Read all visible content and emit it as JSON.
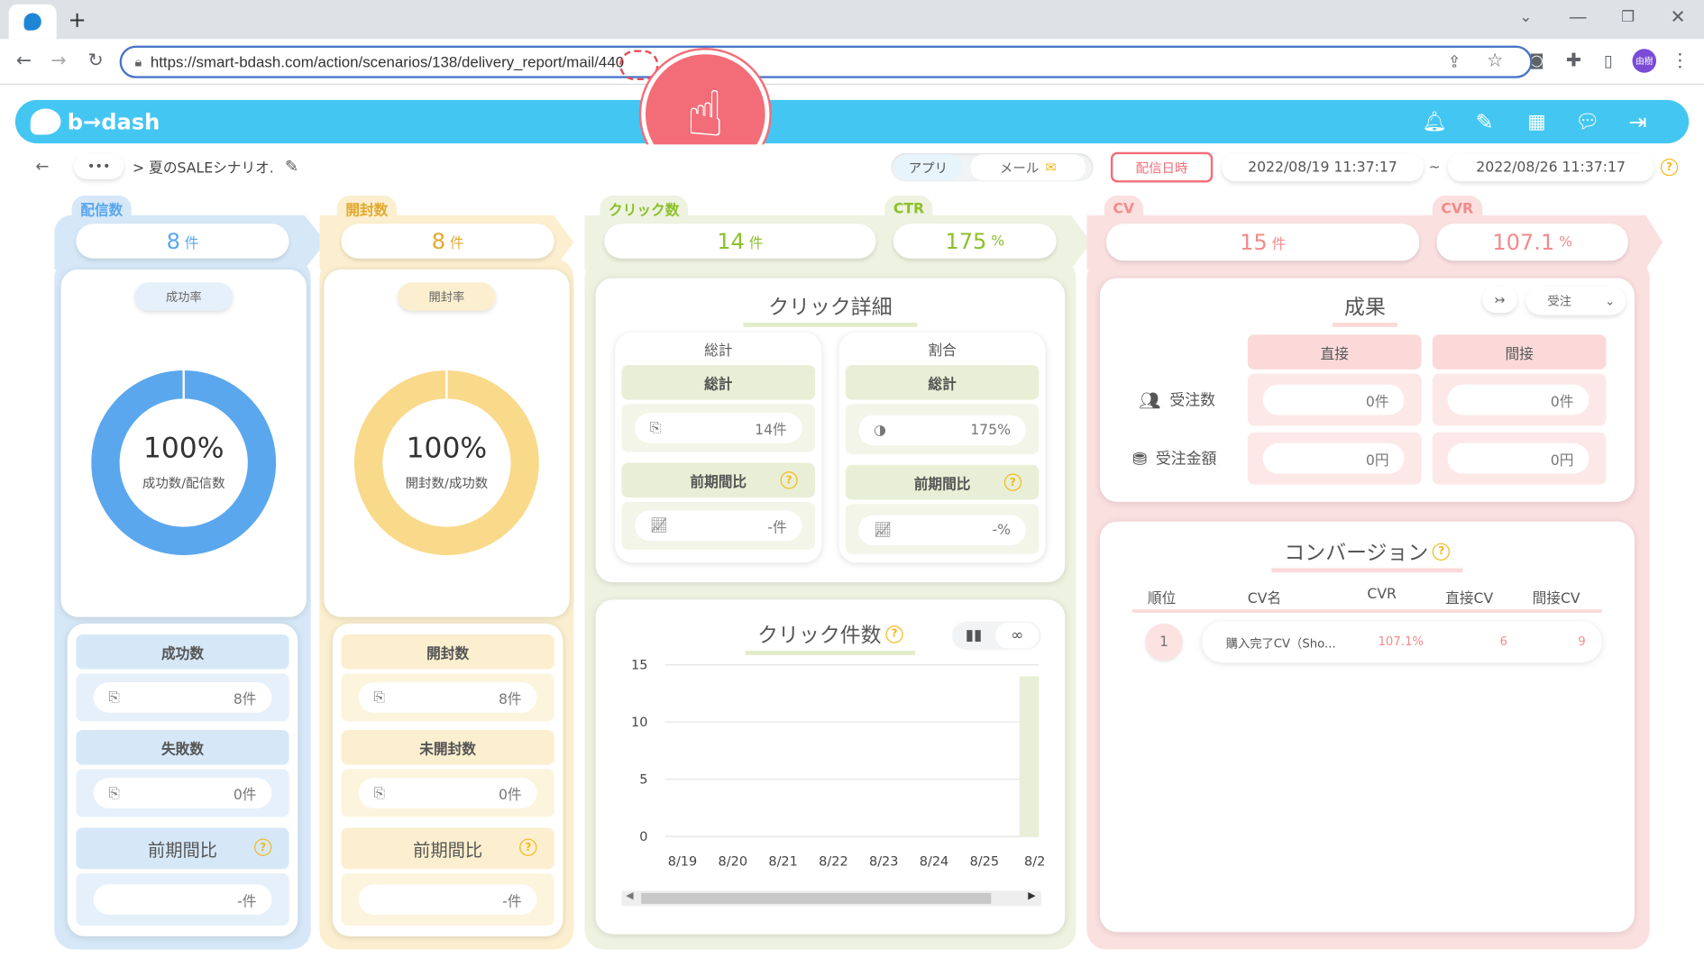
{
  "browser": {
    "url": "https://smart-bdash.com/action/scenarios/138/delivery_report/mail/440",
    "new_tab": "+",
    "profile": "由樹"
  },
  "app": {
    "logo": "b→dash",
    "breadcrumb_more": "•••",
    "breadcrumb_title": "> 夏のSALEシナリオ.",
    "toggle_app": "アプリ",
    "toggle_mail": "メール",
    "date_mode": "配信日時",
    "date_from": "2022/08/19 11:37:17",
    "date_tilde": "~",
    "date_to": "2022/08/26 11:37:17"
  },
  "delivery": {
    "label": "配信数",
    "value": "8",
    "unit": "件",
    "rate_label": "成功率",
    "donut_pct": "100%",
    "donut_sub": "成功数/配信数",
    "donut_value": 100,
    "success_label": "成功数",
    "success_value": "8件",
    "fail_label": "失敗数",
    "fail_value": "0件",
    "prev_label": "前期間比",
    "prev_value": "-件"
  },
  "open": {
    "label": "開封数",
    "value": "8",
    "unit": "件",
    "rate_label": "開封率",
    "donut_pct": "100%",
    "donut_sub": "開封数/成功数",
    "donut_value": 100,
    "open_label": "開封数",
    "open_value": "8件",
    "unopen_label": "未開封数",
    "unopen_value": "0件",
    "prev_label": "前期間比",
    "prev_value": "-件"
  },
  "click": {
    "label": "クリック数",
    "value": "14",
    "unit": "件",
    "ctr_label": "CTR",
    "ctr_value": "175",
    "ctr_unit": "%",
    "detail_title": "クリック詳細",
    "total_title": "総計",
    "total_hd": "総計",
    "total_value": "14件",
    "total_prev_hd": "前期間比",
    "total_prev_value": "-件",
    "ratio_title": "割合",
    "ratio_hd": "総計",
    "ratio_value": "175%",
    "ratio_prev_hd": "前期間比",
    "ratio_prev_value": "-%",
    "chart_title": "クリック件数"
  },
  "cv": {
    "label": "CV",
    "value": "15",
    "unit": "件",
    "cvr_label": "CVR",
    "cvr_value": "107.1",
    "cvr_unit": "%",
    "result_title": "成果",
    "filter_value": "受注",
    "col_direct": "直接",
    "col_indirect": "間接",
    "orders_label": "受注数",
    "orders_direct": "0件",
    "orders_indirect": "0件",
    "amount_label": "受注金額",
    "amount_direct": "0円",
    "amount_indirect": "0円",
    "conv_title": "コンバージョン",
    "conv_headers": [
      "順位",
      "CV名",
      "CVR",
      "直接CV",
      "間接CV"
    ],
    "conv_rows": [
      {
        "rank": "1",
        "name": "購入完了CV（Sho...",
        "cvr": "107.1%",
        "direct": "6",
        "indirect": "9"
      }
    ]
  },
  "chart_data": {
    "type": "bar",
    "categories": [
      "8/19",
      "8/20",
      "8/21",
      "8/22",
      "8/23",
      "8/24",
      "8/25",
      "8/2"
    ],
    "values": [
      0,
      0,
      0,
      0,
      0,
      0,
      0,
      14
    ],
    "ylim": [
      0,
      15
    ],
    "yticks": [
      0,
      5,
      10,
      15
    ],
    "grid": true,
    "colors": {
      "bar": "#e9efd6"
    }
  },
  "colors": {
    "blue": "#5aa7ee",
    "yellow": "#f9d98a",
    "green": "#8cc02a",
    "pink": "#f28b8b",
    "header": "#44c6f2",
    "accent": "#f3b91a"
  }
}
